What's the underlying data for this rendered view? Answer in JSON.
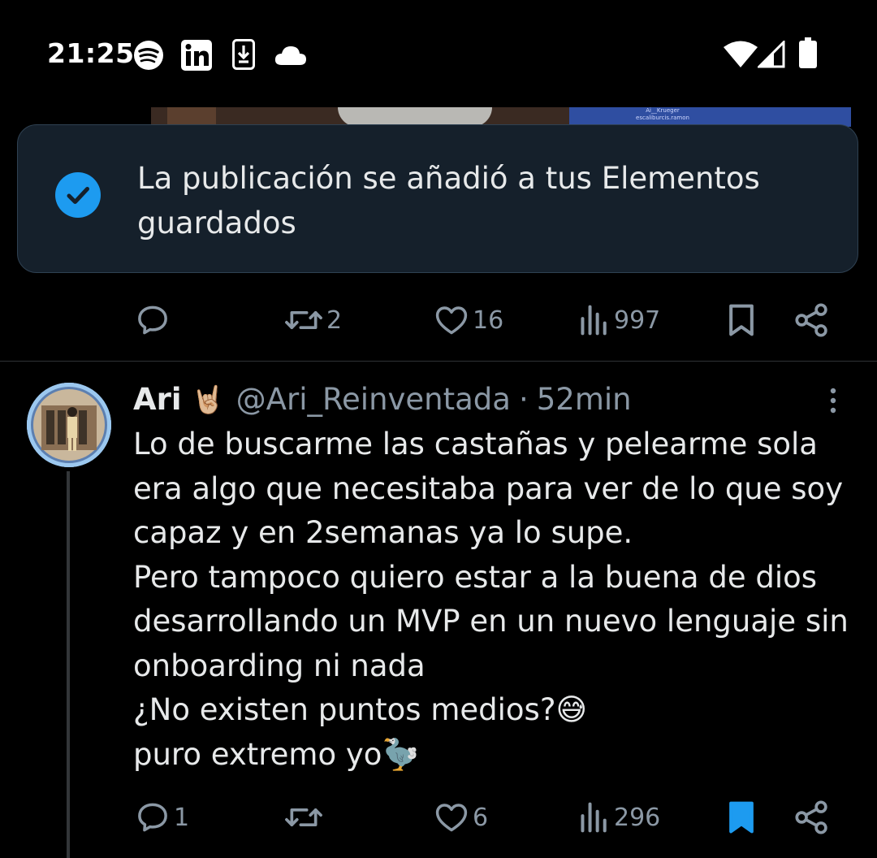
{
  "status_bar": {
    "time": "21:25",
    "left_icons": [
      "spotify-icon",
      "linkedin-icon",
      "download-icon",
      "cloud-icon"
    ],
    "right_icons": [
      "wifi-icon",
      "signal-icon",
      "battery-icon"
    ]
  },
  "media": {
    "caption_line1": "Ai__Krueger",
    "caption_line2": "escaliburcis.ramon"
  },
  "toast": {
    "message": "La publicación se añadió a tus Elementos guardados",
    "accent": "#1d9bf0"
  },
  "post1_actions": {
    "replies": "",
    "reposts": "2",
    "likes": "16",
    "views": "997",
    "bookmarked": false
  },
  "reply": {
    "name": "Ari",
    "name_emoji": "🤘🏼",
    "handle": "@Ari_Reinventada",
    "separator": "·",
    "time": "52min",
    "text": "Lo de buscarme las castañas y pelearme sola era algo que necesitaba para ver de lo que soy capaz y en 2semanas ya lo supe.\nPero tampoco quiero estar a la buena de dios desarrollando un MVP en un nuevo lenguaje sin onboarding ni nada\n¿No existen puntos medios?😅\npuro extremo yo🦤",
    "actions": {
      "replies": "1",
      "reposts": "",
      "likes": "6",
      "views": "296",
      "bookmarked": true
    }
  },
  "colors": {
    "background": "#000000",
    "text": "#e7e9ea",
    "muted": "#8b98a5",
    "bookmark_active": "#1d9bf0",
    "toast_bg": "#15202b"
  }
}
